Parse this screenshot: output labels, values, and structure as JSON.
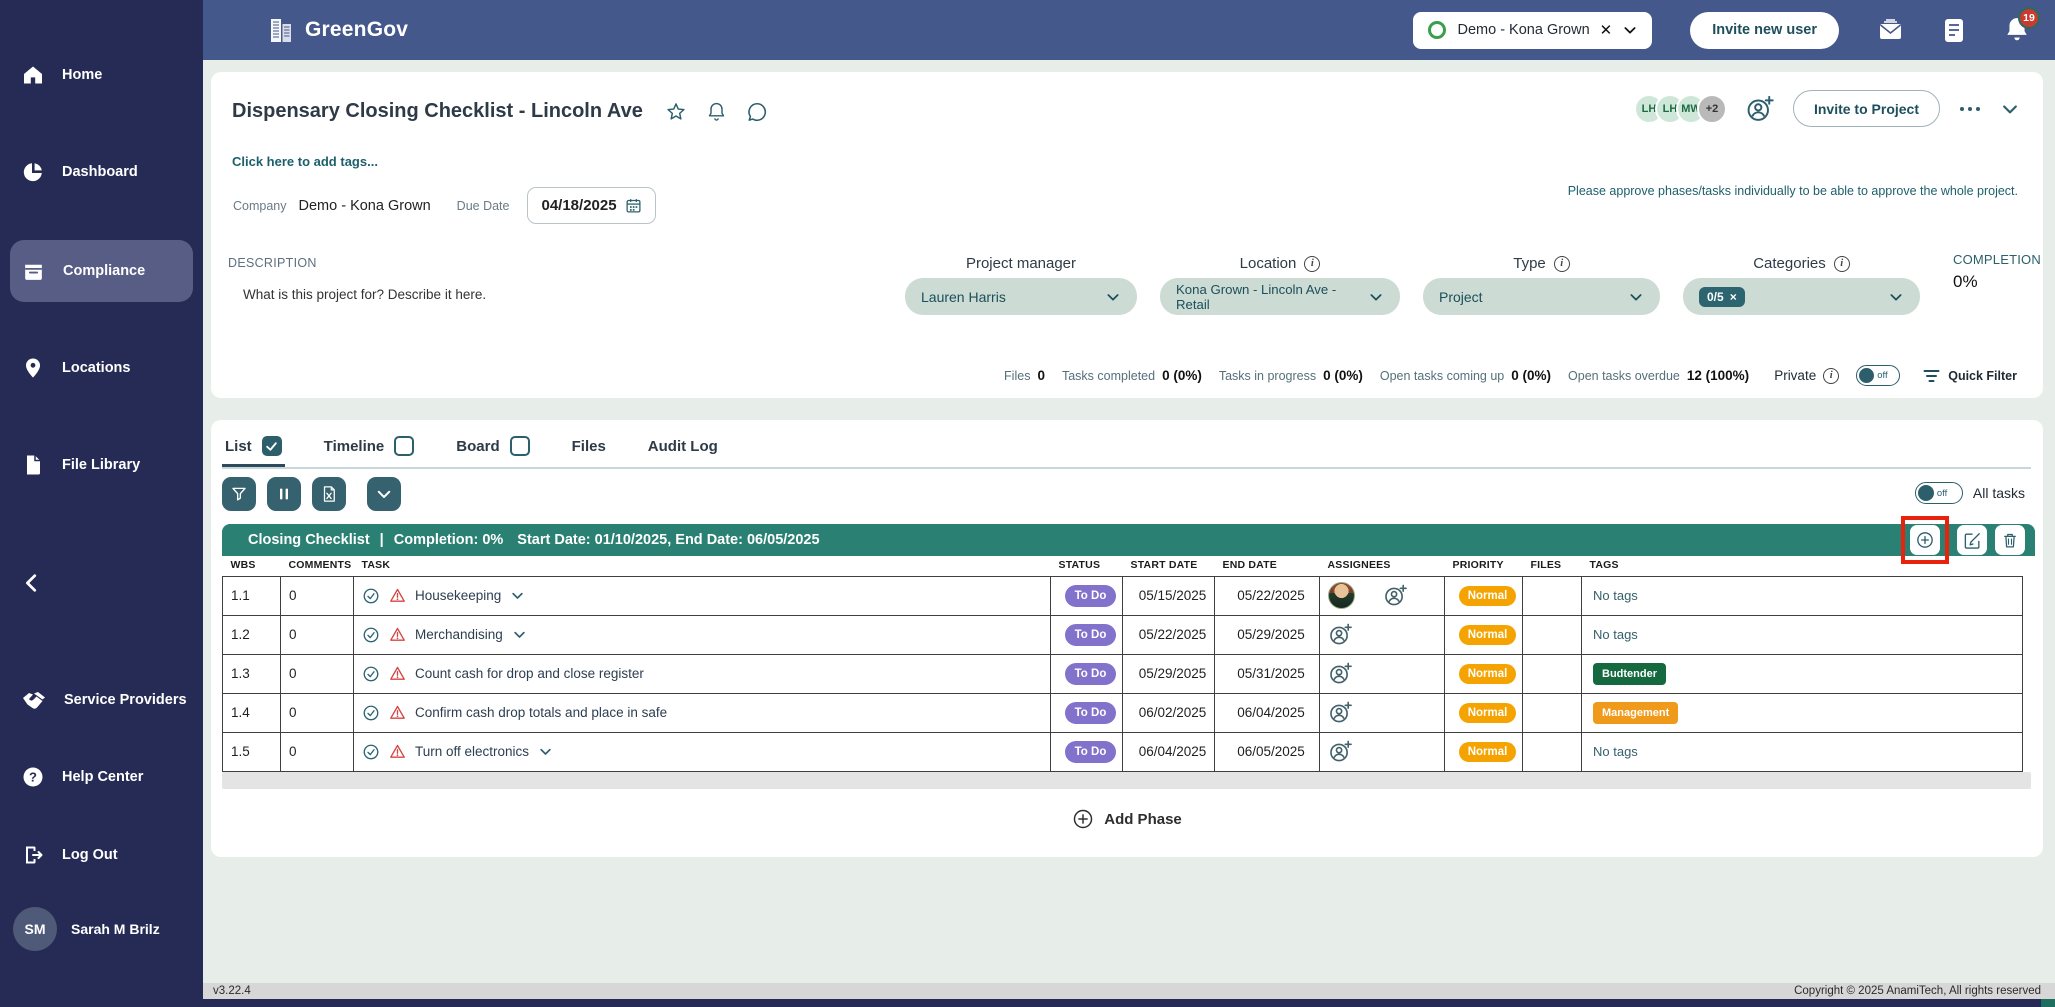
{
  "colors": {
    "topbar_blue": "#45588C",
    "sidebar_navy": "#262B55",
    "accent_teal": "#2C5F6B",
    "phase_green": "#2A8173",
    "status_purple": "#8272CB",
    "priority_orange": "#F5A301",
    "date_green": "#2F9E50",
    "tag_green": "#15693F",
    "tag_orange": "#F09A1C",
    "highlight_red": "#E8230D"
  },
  "topbar": {
    "brand": "GreenGov",
    "company_pill": {
      "label": "Demo - Kona Grown"
    },
    "invite_new_user": "Invite new user",
    "notifications_badge": "19"
  },
  "sidebar": {
    "items": [
      {
        "label": "Home",
        "icon": "home-icon"
      },
      {
        "label": "Dashboard",
        "icon": "dashboard-icon"
      },
      {
        "label": "Compliance",
        "icon": "compliance-icon",
        "active": true
      },
      {
        "label": "Locations",
        "icon": "locations-icon"
      },
      {
        "label": "File Library",
        "icon": "file-library-icon"
      }
    ],
    "secondary": [
      {
        "label": "Service Providers",
        "icon": "handshake-icon"
      },
      {
        "label": "Help Center",
        "icon": "help-icon"
      },
      {
        "label": "Log Out",
        "icon": "logout-icon"
      }
    ],
    "user": {
      "initials": "SM",
      "name": "Sarah M Brilz"
    }
  },
  "project": {
    "title": "Dispensary Closing Checklist - Lincoln Ave",
    "add_tags": "Click here to add tags...",
    "company_label": "Company",
    "company_value": "Demo - Kona Grown",
    "due_date_label": "Due Date",
    "due_date_value": "04/18/2025",
    "approve_note": "Please approve phases/tasks individually to be able to approve the whole project.",
    "description_label": "DESCRIPTION",
    "description_text": "What is this project for? Describe it here.",
    "avatars": [
      {
        "initials": "LH"
      },
      {
        "initials": "LH"
      },
      {
        "initials": "MW"
      },
      {
        "overflow": "+2"
      }
    ],
    "invite_to_project": "Invite to Project",
    "fields": {
      "project_manager": {
        "label": "Project manager",
        "value": "Lauren Harris"
      },
      "location": {
        "label": "Location",
        "value": "Kona Grown - Lincoln Ave - Retail"
      },
      "type": {
        "label": "Type",
        "value": "Project"
      },
      "categories": {
        "label": "Categories",
        "chip": "0/5",
        "chip_close": "×"
      }
    },
    "completion": {
      "label": "COMPLETION",
      "value": "0%"
    },
    "stats": [
      {
        "label": "Files",
        "value": "0"
      },
      {
        "label": "Tasks completed",
        "value": "0 (0%)"
      },
      {
        "label": "Tasks in progress",
        "value": "0 (0%)"
      },
      {
        "label": "Open tasks coming up",
        "value": "0 (0%)"
      },
      {
        "label": "Open tasks overdue",
        "value": "12 (100%)"
      }
    ],
    "private_label": "Private",
    "private_toggle": "off",
    "quick_filter": "Quick Filter"
  },
  "view": {
    "tabs": [
      {
        "label": "List",
        "checkbox": "checked"
      },
      {
        "label": "Timeline",
        "checkbox": "unchecked"
      },
      {
        "label": "Board",
        "checkbox": "unchecked"
      },
      {
        "label": "Files"
      },
      {
        "label": "Audit Log"
      }
    ],
    "all_tasks_toggle": "off",
    "all_tasks_label": "All tasks"
  },
  "phase": {
    "name": "Closing Checklist",
    "separator": "|",
    "completion_text": "Completion: 0%",
    "dates_text": "Start Date: 01/10/2025, End Date: 06/05/2025"
  },
  "table": {
    "columns": [
      "WBS",
      "COMMENTS",
      "TASK",
      "STATUS",
      "START DATE",
      "END DATE",
      "ASSIGNEES",
      "PRIORITY",
      "FILES",
      "TAGS"
    ],
    "rows": [
      {
        "wbs": "1.1",
        "comments": "0",
        "task": "Housekeeping",
        "status": "To Do",
        "start": "05/15/2025",
        "end": "05/22/2025",
        "priority": "Normal",
        "tags": "No tags"
      },
      {
        "wbs": "1.2",
        "comments": "0",
        "task": "Merchandising",
        "status": "To Do",
        "start": "05/22/2025",
        "end": "05/29/2025",
        "priority": "Normal",
        "tags": "No tags"
      },
      {
        "wbs": "1.3",
        "comments": "0",
        "task": "Count cash for drop and close register",
        "status": "To Do",
        "start": "05/29/2025",
        "end": "05/31/2025",
        "priority": "Normal",
        "tag_pill": "Budtender"
      },
      {
        "wbs": "1.4",
        "comments": "0",
        "task": "Confirm cash drop totals and place in safe",
        "status": "To Do",
        "start": "06/02/2025",
        "end": "06/04/2025",
        "priority": "Normal",
        "tag_pill": "Management"
      },
      {
        "wbs": "1.5",
        "comments": "0",
        "task": "Turn off electronics",
        "status": "To Do",
        "start": "06/04/2025",
        "end": "06/05/2025",
        "priority": "Normal",
        "tags": "No tags"
      }
    ],
    "add_phase": "Add Phase"
  },
  "footer": {
    "version": "v3.22.4",
    "copyright": "Copyright © 2025 AnamiTech, All rights reserved"
  }
}
